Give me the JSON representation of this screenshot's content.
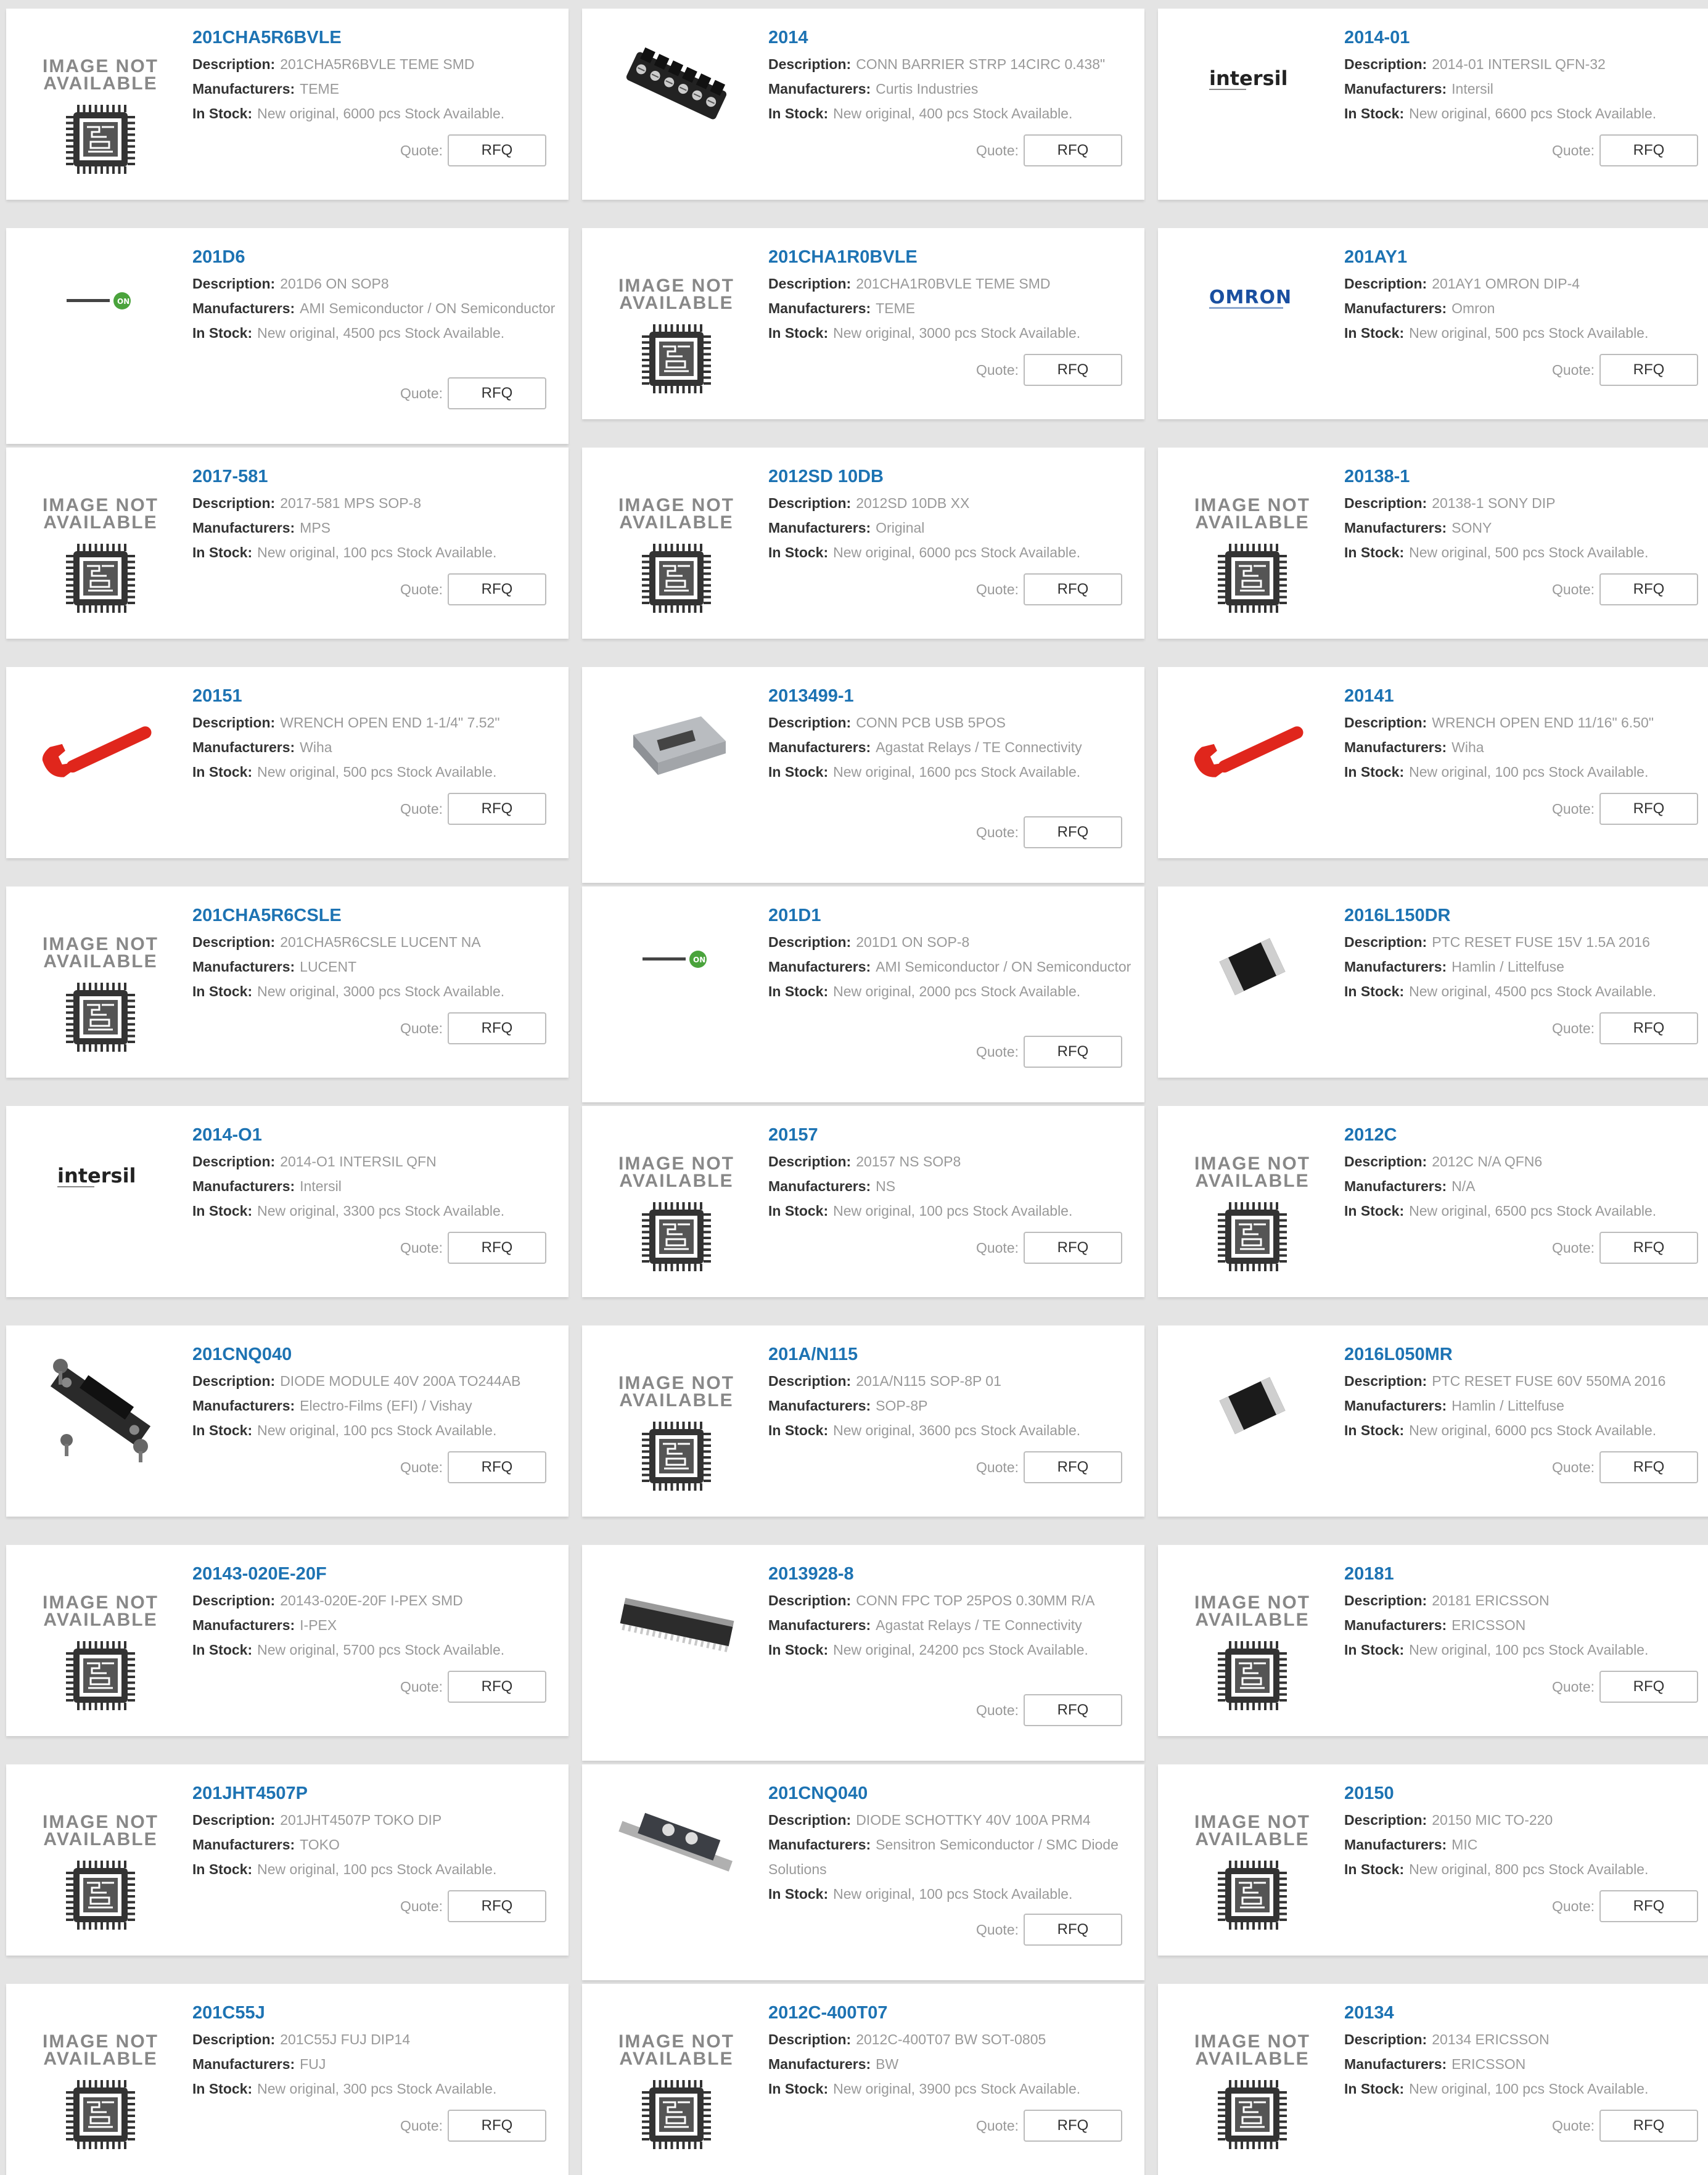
{
  "labels": {
    "description": "Description:",
    "manufacturers": "Manufacturers:",
    "in_stock": "In Stock:",
    "quote": "Quote:",
    "rfq": "RFQ",
    "not_available_line1": "IMAGE NOT",
    "not_available_line2": "AVAILABLE"
  },
  "colors": {
    "accent": "#1d73b3",
    "page_bg": "#e4e4e4",
    "card_bg": "#ffffff",
    "label": "#333333",
    "value": "#999999"
  },
  "products": [
    {
      "part": "201CHA5R6BVLE",
      "description": "201CHA5R6BVLE TEME SMD",
      "manufacturer": "TEME",
      "stock": "New original, 6000 pcs Stock Available.",
      "image": "not-available"
    },
    {
      "part": "2014",
      "description": "CONN BARRIER STRP 14CIRC 0.438\"",
      "manufacturer": "Curtis Industries",
      "stock": "New original, 400 pcs Stock Available.",
      "image": "barrier-strip"
    },
    {
      "part": "2014-01",
      "description": "2014-01 INTERSIL QFN-32",
      "manufacturer": "Intersil",
      "stock": "New original, 6600 pcs Stock Available.",
      "image": "intersil-logo"
    },
    {
      "part": "201D6",
      "description": "201D6 ON SOP8",
      "manufacturer": "AMI Semiconductor / ON Semiconductor",
      "stock": "New original, 4500 pcs Stock Available.",
      "image": "on-semi-logo"
    },
    {
      "part": "201CHA1R0BVLE",
      "description": "201CHA1R0BVLE TEME SMD",
      "manufacturer": "TEME",
      "stock": "New original, 3000 pcs Stock Available.",
      "image": "not-available"
    },
    {
      "part": "201AY1",
      "description": "201AY1 OMRON DIP-4",
      "manufacturer": "Omron",
      "stock": "New original, 500 pcs Stock Available.",
      "image": "omron-logo"
    },
    {
      "part": "2017-581",
      "description": "2017-581 MPS SOP-8",
      "manufacturer": "MPS",
      "stock": "New original, 100 pcs Stock Available.",
      "image": "not-available"
    },
    {
      "part": "2012SD 10DB",
      "description": "2012SD 10DB    XX",
      "manufacturer": "Original",
      "stock": "New original, 6000 pcs Stock Available.",
      "image": "not-available"
    },
    {
      "part": "20138-1",
      "description": "20138-1 SONY DIP",
      "manufacturer": "SONY",
      "stock": "New original, 500 pcs Stock Available.",
      "image": "not-available"
    },
    {
      "part": "20151",
      "description": "WRENCH OPEN END 1-1/4\" 7.52\"",
      "manufacturer": "Wiha",
      "stock": "New original, 500 pcs Stock Available.",
      "image": "wrench"
    },
    {
      "part": "2013499-1",
      "description": "CONN PCB USB 5POS",
      "manufacturer": "Agastat Relays / TE Connectivity",
      "stock": "New original, 1600 pcs Stock Available.",
      "image": "usb-connector"
    },
    {
      "part": "20141",
      "description": "WRENCH OPEN END 11/16\" 6.50\"",
      "manufacturer": "Wiha",
      "stock": "New original, 100 pcs Stock Available.",
      "image": "wrench"
    },
    {
      "part": "201CHA5R6CSLE",
      "description": "201CHA5R6CSLE LUCENT NA",
      "manufacturer": "LUCENT",
      "stock": "New original, 3000 pcs Stock Available.",
      "image": "not-available"
    },
    {
      "part": "201D1",
      "description": "201D1 ON SOP-8",
      "manufacturer": "AMI Semiconductor / ON Semiconductor",
      "stock": "New original, 2000 pcs Stock Available.",
      "image": "on-semi-logo"
    },
    {
      "part": "2016L150DR",
      "description": "PTC RESET FUSE 15V 1.5A 2016",
      "manufacturer": "Hamlin / Littelfuse",
      "stock": "New original, 4500 pcs Stock Available.",
      "image": "fuse-chip"
    },
    {
      "part": "2014-O1",
      "description": "2014-O1 INTERSIL QFN",
      "manufacturer": "Intersil",
      "stock": "New original, 3300 pcs Stock Available.",
      "image": "intersil-logo"
    },
    {
      "part": "20157",
      "description": "20157 NS SOP8",
      "manufacturer": "NS",
      "stock": "New original, 100 pcs Stock Available.",
      "image": "not-available"
    },
    {
      "part": "2012C",
      "description": "2012C N/A QFN6",
      "manufacturer": "N/A",
      "stock": "New original, 6500 pcs Stock Available.",
      "image": "not-available"
    },
    {
      "part": "201CNQ040",
      "description": "DIODE MODULE 40V 200A TO244AB",
      "manufacturer": "Electro-Films (EFI) / Vishay",
      "stock": "New original, 100 pcs Stock Available.",
      "image": "diode-module"
    },
    {
      "part": "201A/N115",
      "description": "201A/N115 SOP-8P 01",
      "manufacturer": "SOP-8P",
      "stock": "New original, 3600 pcs Stock Available.",
      "image": "not-available"
    },
    {
      "part": "2016L050MR",
      "description": "PTC RESET FUSE 60V 550MA 2016",
      "manufacturer": "Hamlin / Littelfuse",
      "stock": "New original, 6000 pcs Stock Available.",
      "image": "fuse-chip"
    },
    {
      "part": "20143-020E-20F",
      "description": "20143-020E-20F I-PEX SMD",
      "manufacturer": "I-PEX",
      "stock": "New original, 5700 pcs Stock Available.",
      "image": "not-available"
    },
    {
      "part": "2013928-8",
      "description": "CONN FPC TOP 25POS 0.30MM R/A",
      "manufacturer": "Agastat Relays / TE Connectivity",
      "stock": "New original, 24200 pcs Stock Available.",
      "image": "fpc-connector"
    },
    {
      "part": "20181",
      "description": "20181 ERICSSON",
      "manufacturer": "ERICSSON",
      "stock": "New original, 100 pcs Stock Available.",
      "image": "not-available"
    },
    {
      "part": "201JHT4507P",
      "description": "201JHT4507P TOKO DIP",
      "manufacturer": "TOKO",
      "stock": "New original, 100 pcs Stock Available.",
      "image": "not-available"
    },
    {
      "part": "201CNQ040",
      "description": "DIODE SCHOTTKY 40V 100A PRM4",
      "manufacturer": "Sensitron Semiconductor / SMC Diode Solutions",
      "stock": "New original, 100 pcs Stock Available.",
      "image": "schottky-module"
    },
    {
      "part": "20150",
      "description": "20150 MIC TO-220",
      "manufacturer": "MIC",
      "stock": "New original, 800 pcs Stock Available.",
      "image": "not-available"
    },
    {
      "part": "201C55J",
      "description": "201C55J FUJ DIP14",
      "manufacturer": "FUJ",
      "stock": "New original, 300 pcs Stock Available.",
      "image": "not-available"
    },
    {
      "part": "2012C-400T07",
      "description": "2012C-400T07 BW SOT-0805",
      "manufacturer": "BW",
      "stock": "New original, 3900 pcs Stock Available.",
      "image": "not-available"
    },
    {
      "part": "20134",
      "description": "20134 ERICSSON",
      "manufacturer": "ERICSSON",
      "stock": "New original, 100 pcs Stock Available.",
      "image": "not-available"
    }
  ]
}
